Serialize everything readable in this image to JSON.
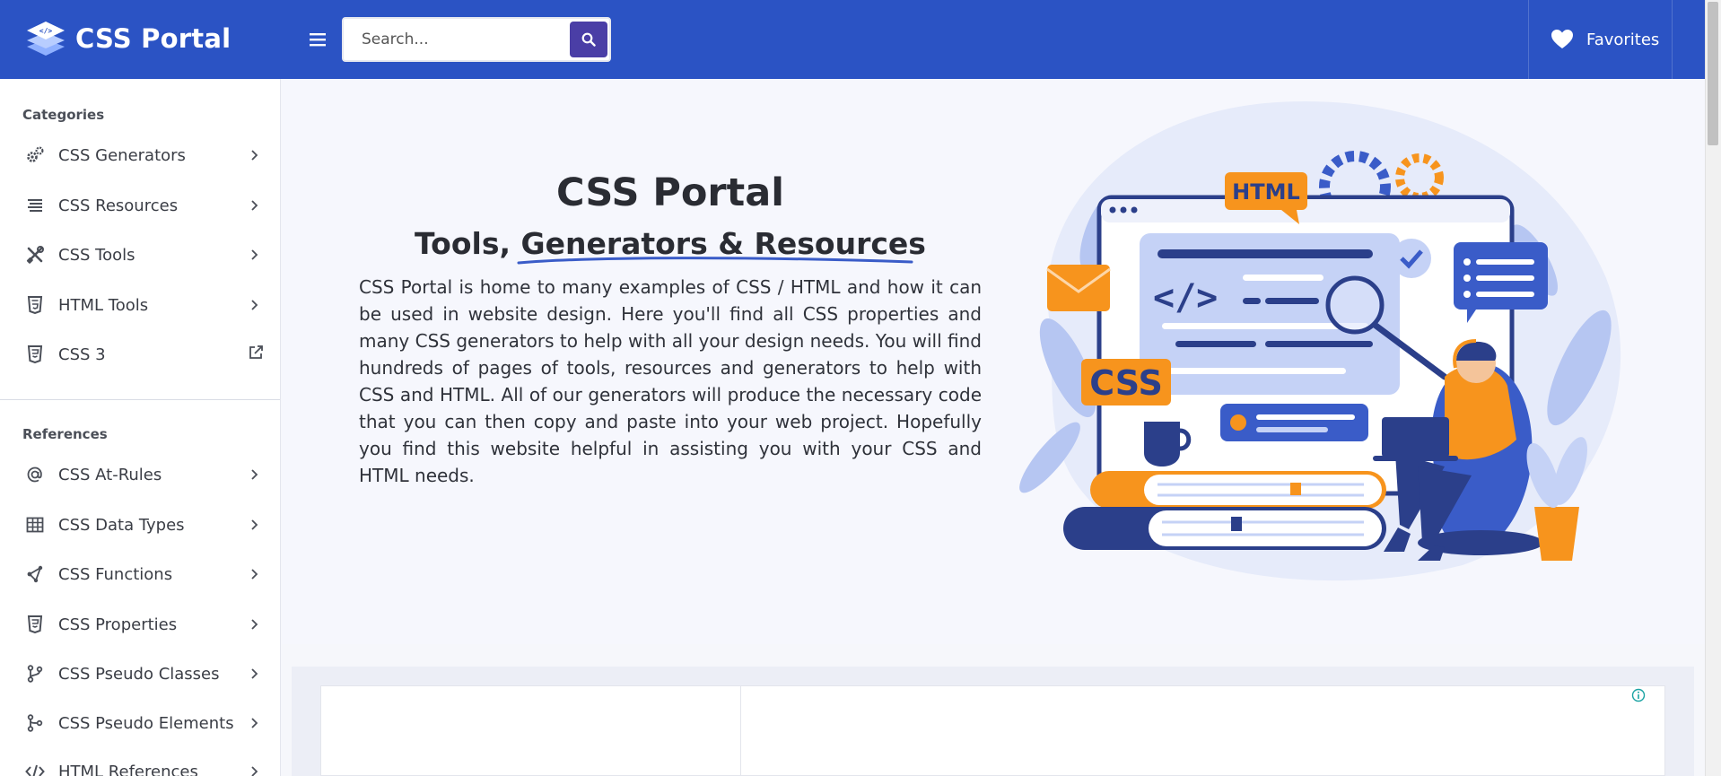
{
  "header": {
    "logo_text": "CSS Portal",
    "logo_icon": "layers-code-icon",
    "menu_icon": "hamburger-icon",
    "search": {
      "placeholder": "Search...",
      "value": "",
      "button_icon": "search-icon"
    },
    "favorites": {
      "label": "Favorites",
      "icon": "heart-icon"
    }
  },
  "sidebar": {
    "categories_title": "Categories",
    "categories": [
      {
        "label": "CSS Generators",
        "icon": "gears-icon",
        "trail": "chevron-right-icon"
      },
      {
        "label": "CSS Resources",
        "icon": "list-lines-icon",
        "trail": "chevron-right-icon"
      },
      {
        "label": "CSS Tools",
        "icon": "tools-icon",
        "trail": "chevron-right-icon"
      },
      {
        "label": "HTML Tools",
        "icon": "html5-icon",
        "trail": "chevron-right-icon"
      },
      {
        "label": "CSS 3",
        "icon": "css3-icon",
        "trail": "external-link-icon"
      }
    ],
    "references_title": "References",
    "references": [
      {
        "label": "CSS At-Rules",
        "icon": "at-sign-icon"
      },
      {
        "label": "CSS Data Types",
        "icon": "table-icon"
      },
      {
        "label": "CSS Functions",
        "icon": "function-nodes-icon"
      },
      {
        "label": "CSS Properties",
        "icon": "css3-icon"
      },
      {
        "label": "CSS Pseudo Classes",
        "icon": "git-branch-icon"
      },
      {
        "label": "CSS Pseudo Elements",
        "icon": "git-fork-icon"
      },
      {
        "label": "HTML References",
        "icon": "code-icon"
      }
    ]
  },
  "hero": {
    "title": "CSS Portal",
    "subtitle": "Tools, Generators & Resources",
    "description": "CSS Portal is home to many examples of CSS / HTML and how it can be used in website design. Here you'll find all CSS properties and many CSS generators to help with all your design needs. You will find hundreds of pages of tools, resources and generators to help with CSS and HTML. All of our generators will produce the necessary code that you can then copy and paste into your web project. Hopefully you find this website helpful in assisting you with your CSS and HTML needs.",
    "illustration": {
      "badge_html": "HTML",
      "badge_css": "CSS",
      "code_glyph": "</>"
    }
  },
  "ad": {
    "info_icon": "info-icon"
  },
  "colors": {
    "header_bg": "#2b53c4",
    "search_button": "#4a3ea6",
    "accent_orange": "#f7941d",
    "illustration_blue": "#3a5cc8"
  }
}
